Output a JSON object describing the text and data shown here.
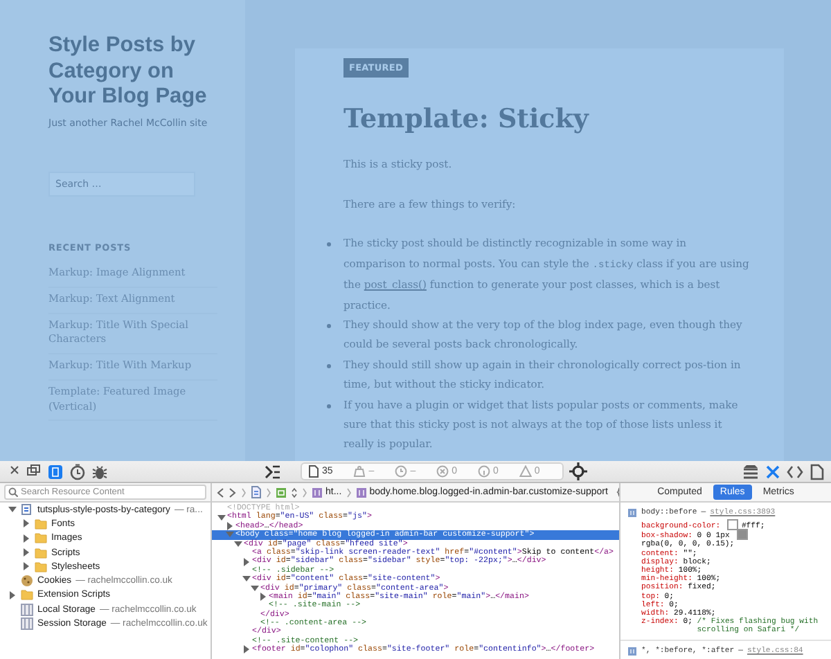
{
  "page": {
    "site_title": "Style Posts by Category on Your Blog Page",
    "site_description": "Just another Rachel McCollin site",
    "search": {
      "placeholder": "Search …"
    },
    "widget_title": "RECENT POSTS",
    "recent_posts": [
      "Markup: Image Alignment",
      "Markup: Text Alignment",
      "Markup: Title With Special Characters",
      "Markup: Title With Markup",
      "Template: Featured Image (Vertical)"
    ],
    "article": {
      "badge": "FEATURED",
      "title": "Template: Sticky",
      "paragraphs": [
        "This is a sticky post.",
        "There are a few things to verify:"
      ],
      "items": [
        [
          {
            "kind": "text",
            "text": "The sticky post should be distinctly recognizable in some way in comparison to normal posts. You can style the "
          },
          {
            "kind": "code",
            "text": ".sticky"
          },
          {
            "kind": "text",
            "text": " class if you are using the "
          },
          {
            "kind": "link",
            "text": "post_class()"
          },
          {
            "kind": "text",
            "text": " function to generate your post classes, which is a best practice."
          }
        ],
        [
          {
            "kind": "text",
            "text": "They should show at the very top of the blog index page, even though they could be several posts back chronologically."
          }
        ],
        [
          {
            "kind": "text",
            "text": "They should still show up again in their chronologically correct pos-tion in time, but without the sticky indicator."
          }
        ],
        [
          {
            "kind": "text",
            "text": "If you have a plugin or widget that lists popular posts or comments, make sure that this sticky post is not always at the top of those lists unless it really is popular."
          }
        ]
      ]
    }
  },
  "devtools": {
    "left_tools": [
      {
        "kind": "close",
        "selected": false
      },
      {
        "kind": "undock",
        "selected": false
      },
      {
        "kind": "resources",
        "selected": true
      },
      {
        "kind": "timeline",
        "selected": false
      },
      {
        "kind": "debugger",
        "selected": false
      }
    ],
    "activity": [
      {
        "kind": "resources",
        "text": "35"
      },
      {
        "kind": "size",
        "text": "–"
      },
      {
        "kind": "time",
        "text": "–"
      },
      {
        "kind": "errors",
        "text": "0"
      },
      {
        "kind": "logs",
        "text": "0"
      },
      {
        "kind": "warnings",
        "text": "0"
      }
    ],
    "right_tools": [
      {
        "kind": "layers",
        "selected": false
      },
      {
        "kind": "styles",
        "selected": true
      },
      {
        "kind": "code",
        "selected": false
      },
      {
        "kind": "document",
        "selected": false
      }
    ],
    "resource_search": {
      "placeholder": "Search Resource Content"
    },
    "resources": [
      {
        "kind": "site",
        "label": "tutsplus-style-posts-by-category",
        "detail": "— ra...",
        "expanded": true,
        "children": [
          {
            "kind": "folder",
            "label": "Fonts",
            "expanded": false
          },
          {
            "kind": "folder",
            "label": "Images",
            "expanded": false
          },
          {
            "kind": "folder",
            "label": "Scripts",
            "expanded": false
          },
          {
            "kind": "folder",
            "label": "Stylesheets",
            "expanded": false
          }
        ]
      },
      {
        "kind": "cookies",
        "label": "Cookies",
        "detail": "— rachelmccollin.co.uk"
      },
      {
        "kind": "folder",
        "label": "Extension Scripts",
        "expanded": false
      },
      {
        "kind": "storage",
        "label": "Local Storage",
        "detail": "— rachelmccollin.co.uk"
      },
      {
        "kind": "storage",
        "label": "Session Storage",
        "detail": "— rachelmccollin.co.uk"
      }
    ],
    "breadcrumb": [
      {
        "kind": "document"
      },
      {
        "kind": "frame"
      },
      {
        "kind": "element",
        "text": "ht..."
      },
      {
        "kind": "element",
        "text": "body.home.blog.logged-in.admin-bar.customize-support"
      }
    ],
    "dom": [
      {
        "kind": "doctype",
        "text": "<!DOCTYPE html>",
        "selected": false
      },
      {
        "kind": "node",
        "text": "<html lang=\"en-US\" class=\"js\">",
        "expanded": true,
        "selected": false,
        "children": [
          {
            "kind": "node",
            "text": "<head>…</head>",
            "expanded": false,
            "selected": false
          },
          {
            "kind": "node",
            "text": "<body class=\"home blog logged-in admin-bar customize-support\">",
            "expanded": true,
            "selected": true,
            "children": [
              {
                "kind": "node",
                "text": "<div id=\"page\" class=\"hfeed site\">",
                "expanded": true,
                "selected": false,
                "children": [
                  {
                    "kind": "leaf",
                    "text": "<a class=\"skip-link screen-reader-text\" href=\"#content\">Skip to content</a>",
                    "selected": false
                  },
                  {
                    "kind": "node",
                    "text": "<div id=\"sidebar\" class=\"sidebar\" style=\"top: -22px;\">…</div>",
                    "expanded": false,
                    "selected": false
                  },
                  {
                    "kind": "leaf",
                    "text": "<!-- .sidebar -->",
                    "selected": false
                  },
                  {
                    "kind": "node",
                    "text": "<div id=\"content\" class=\"site-content\">",
                    "expanded": true,
                    "selected": false,
                    "close": "</div>",
                    "children": [
                      {
                        "kind": "node",
                        "text": "<div id=\"primary\" class=\"content-area\">",
                        "expanded": true,
                        "selected": false,
                        "close": "</div>",
                        "children": [
                          {
                            "kind": "node",
                            "text": "<main id=\"main\" class=\"site-main\" role=\"main\">…</main>",
                            "expanded": false,
                            "selected": false
                          },
                          {
                            "kind": "leaf",
                            "text": "<!-- .site-main -->",
                            "selected": false
                          }
                        ]
                      },
                      {
                        "kind": "leaf",
                        "text": "<!-- .content-area -->",
                        "selected": false
                      }
                    ]
                  },
                  {
                    "kind": "leaf",
                    "text": "<!-- .site-content -->",
                    "selected": false
                  },
                  {
                    "kind": "node",
                    "text": "<footer id=\"colophon\" class=\"site-footer\" role=\"contentinfo\">…</footer>",
                    "expanded": false,
                    "selected": false
                  }
                ]
              }
            ]
          }
        ]
      }
    ],
    "style_tabs": [
      {
        "label": "Computed",
        "selected": false
      },
      {
        "label": "Rules",
        "selected": true
      },
      {
        "label": "Metrics",
        "selected": false
      }
    ],
    "rules": [
      {
        "selector": "body::before",
        "separator": "—",
        "source": "style.css:3893",
        "properties": [
          {
            "name": "background-color:",
            "color": "#ffffff",
            "value": "#fff;"
          },
          {
            "name": "box-shadow:",
            "lead": "0 0 1px",
            "color": "#8e8e8e",
            "value": "rgba(0, 0, 0, 0.15);"
          },
          {
            "name": "content:",
            "value": "\"\";"
          },
          {
            "name": "display:",
            "value": "block;"
          },
          {
            "name": "height:",
            "value": "100%;"
          },
          {
            "name": "min-height:",
            "value": "100%;"
          },
          {
            "name": "position:",
            "value": "fixed;"
          },
          {
            "name": "top:",
            "value": "0;"
          },
          {
            "name": "left:",
            "value": "0;"
          },
          {
            "name": "width:",
            "value": "29.4118%;"
          },
          {
            "name": "z-index:",
            "value": "0;",
            "comment": "/* Fixes flashing bug with scrolling on Safari */"
          }
        ]
      },
      {
        "selector": "*, *:before, *:after",
        "separator": "—",
        "source": "style.css:84"
      }
    ]
  }
}
